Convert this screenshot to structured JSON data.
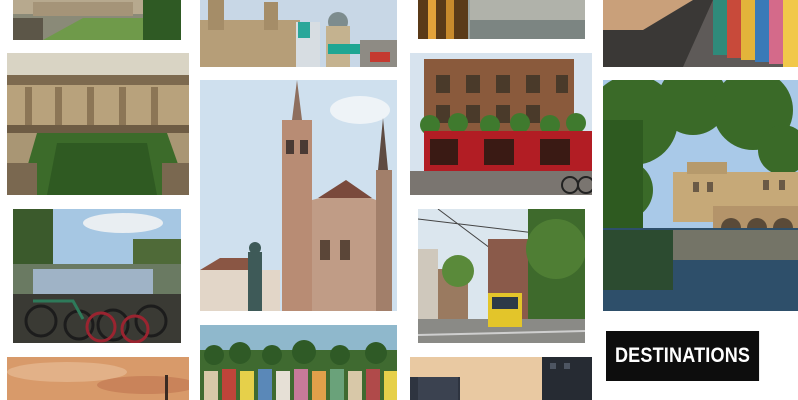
{
  "banner": {
    "title": "DESTINATIONS"
  }
}
